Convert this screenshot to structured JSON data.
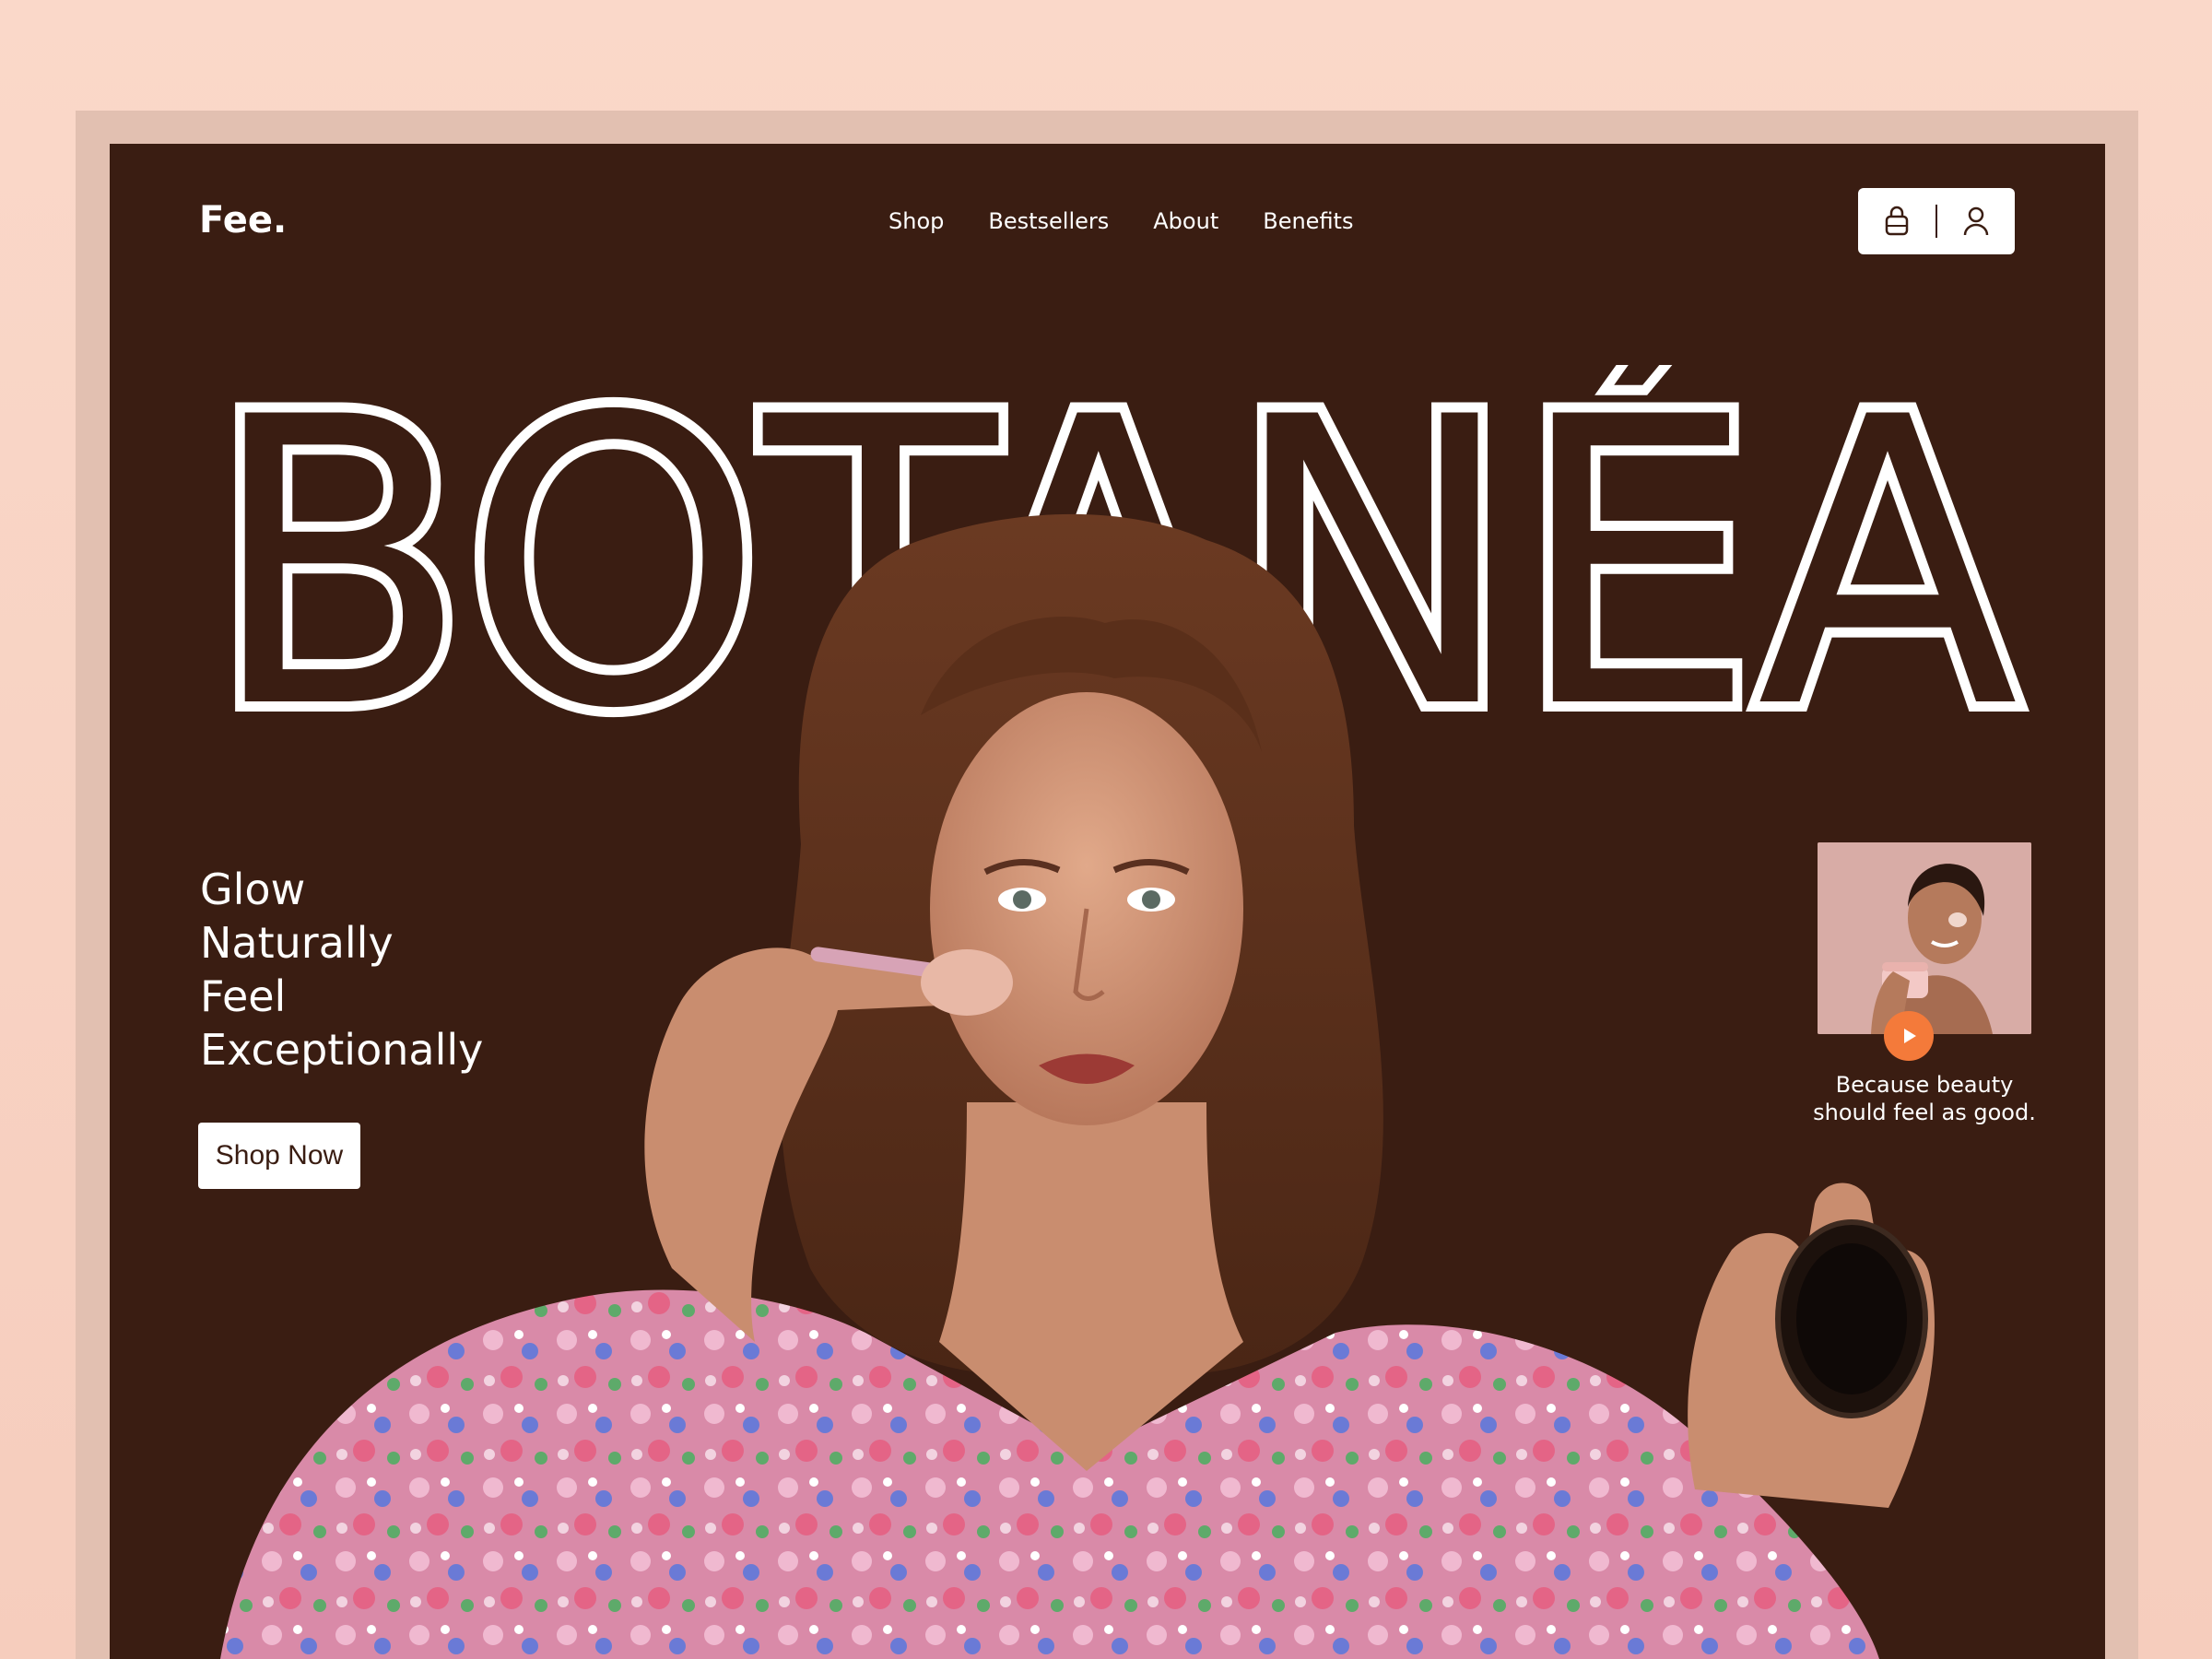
{
  "brand": {
    "logo_text": "Fee."
  },
  "nav": {
    "items": [
      "Shop",
      "Bestsellers",
      "About",
      "Benefits"
    ]
  },
  "header_actions": {
    "icons": [
      "shopping-bag-icon",
      "user-icon"
    ]
  },
  "hero": {
    "title": "BOTANÉA",
    "tagline": [
      "Glow",
      "Naturally",
      "Feel",
      "Exceptionally"
    ],
    "cta_label": "Shop Now"
  },
  "video": {
    "caption_line1": "Because beauty",
    "caption_line2": "should feel as good.",
    "play_icon": "play-icon"
  },
  "colors": {
    "background_outer": "#fad8c9",
    "frame": "#e2c0b1",
    "screen": "#3a1d12",
    "text": "#ffffff",
    "accent": "#f47a3a"
  }
}
